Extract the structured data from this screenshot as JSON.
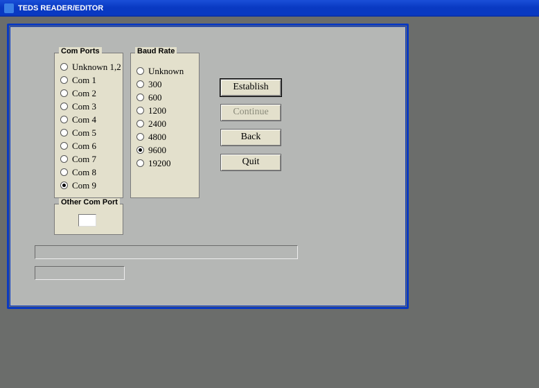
{
  "window": {
    "title": "TEDS READER/EDITOR"
  },
  "comports": {
    "legend": "Com Ports",
    "options": [
      "Unknown 1,2",
      "Com 1",
      "Com 2",
      "Com 3",
      "Com 4",
      "Com 5",
      "Com 6",
      "Com 7",
      "Com 8",
      "Com 9"
    ],
    "selected": "Com 9"
  },
  "baudrate": {
    "legend": "Baud Rate",
    "options": [
      "Unknown",
      "300",
      "600",
      "1200",
      "2400",
      "4800",
      "9600",
      "19200"
    ],
    "selected": "9600"
  },
  "othercom": {
    "legend": "Other Com Port",
    "value": ""
  },
  "buttons": {
    "establish": "Establish",
    "continue": "Continue",
    "back": "Back",
    "quit": "Quit"
  },
  "status1": "",
  "status2": ""
}
